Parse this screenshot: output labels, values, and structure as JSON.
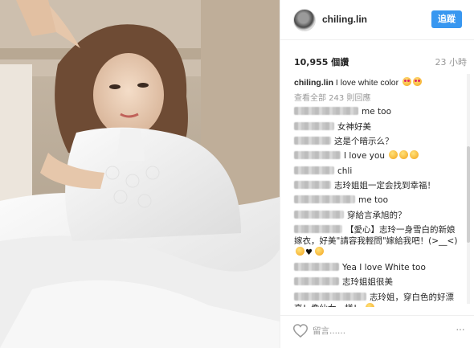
{
  "post": {
    "username": "chiling.lin",
    "follow_label": "追蹤",
    "likes": "10,955 個讚",
    "time_ago": "23 小時",
    "caption_user": "chiling.lin",
    "caption_text": "I love white color",
    "view_all": "查看全部 243 則回應"
  },
  "comments": [
    {
      "text": "me too",
      "emoji": ""
    },
    {
      "text": "女神好美",
      "emoji": ""
    },
    {
      "text": "这是个暗示么？",
      "emoji": ""
    },
    {
      "text": "I love you",
      "emoji": "3x grin"
    },
    {
      "text": "chli",
      "emoji": ""
    },
    {
      "text": "志玲姐姐一定会找到幸福！",
      "emoji": ""
    },
    {
      "text": "me too",
      "emoji": ""
    },
    {
      "text": "穿給言承旭的？",
      "emoji": ""
    },
    {
      "text": "【愛心】志玲一身雪白的新娘嫁衣，好美\"請容我輕問\"嫁給我吧！(>__<)",
      "emoji": "smile heart smile"
    },
    {
      "text": "Yea I love White too",
      "emoji": ""
    },
    {
      "text": "志玲姐姐很美",
      "emoji": ""
    },
    {
      "text": "志玲姐，穿白色的好漂亮！像仙女一樣！",
      "emoji": "smile"
    }
  ],
  "footer": {
    "comment_placeholder": "留言......",
    "more_label": "···"
  },
  "icons": {
    "like": "heart-outline-icon",
    "options": "more-horizontal-icon",
    "follow_accent": "#3897f0"
  }
}
